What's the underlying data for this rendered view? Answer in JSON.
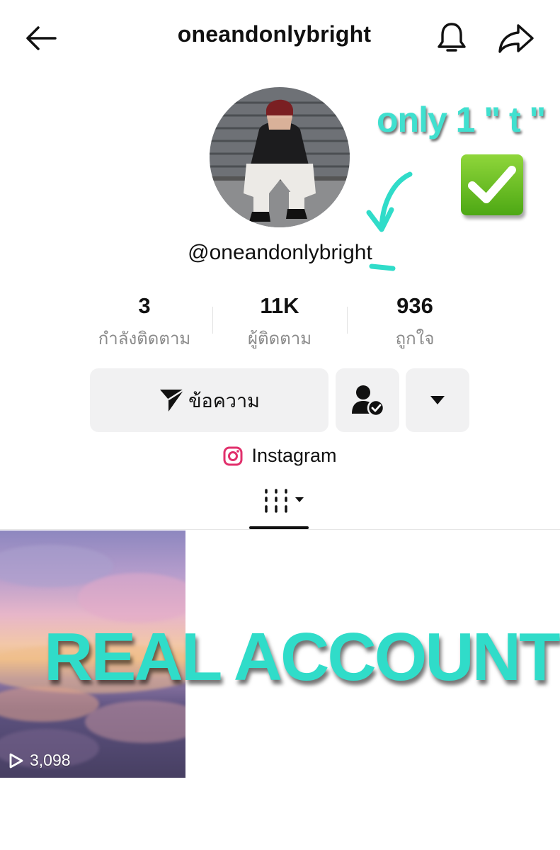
{
  "header": {
    "title": "oneandonlybright",
    "back_icon": "arrow-left-icon",
    "notify_icon": "bell-icon",
    "share_icon": "share-arrow-icon"
  },
  "profile": {
    "handle": "@oneandonlybright",
    "avatar_icon": "profile-photo"
  },
  "annotation": {
    "note": "only 1 \" t \"",
    "check_icon": "check-mark-icon",
    "accent_color": "#40e0cf"
  },
  "stats": [
    {
      "value": "3",
      "label": "กำลังติดตาม"
    },
    {
      "value": "11K",
      "label": "ผู้ติดตาม"
    },
    {
      "value": "936",
      "label": "ถูกใจ"
    }
  ],
  "actions": {
    "message_label": "ข้อความ",
    "message_icon": "send-icon",
    "following_icon": "user-check-icon",
    "more_icon": "caret-down-icon"
  },
  "link": {
    "label": "Instagram",
    "icon": "instagram-icon",
    "color": "#e1306c"
  },
  "tabs": {
    "grid_icon": "grid-filter-icon"
  },
  "videos": [
    {
      "views": "3,098",
      "icon": "play-icon"
    }
  ],
  "overlay": {
    "text": "REAL ACCOUNT"
  }
}
